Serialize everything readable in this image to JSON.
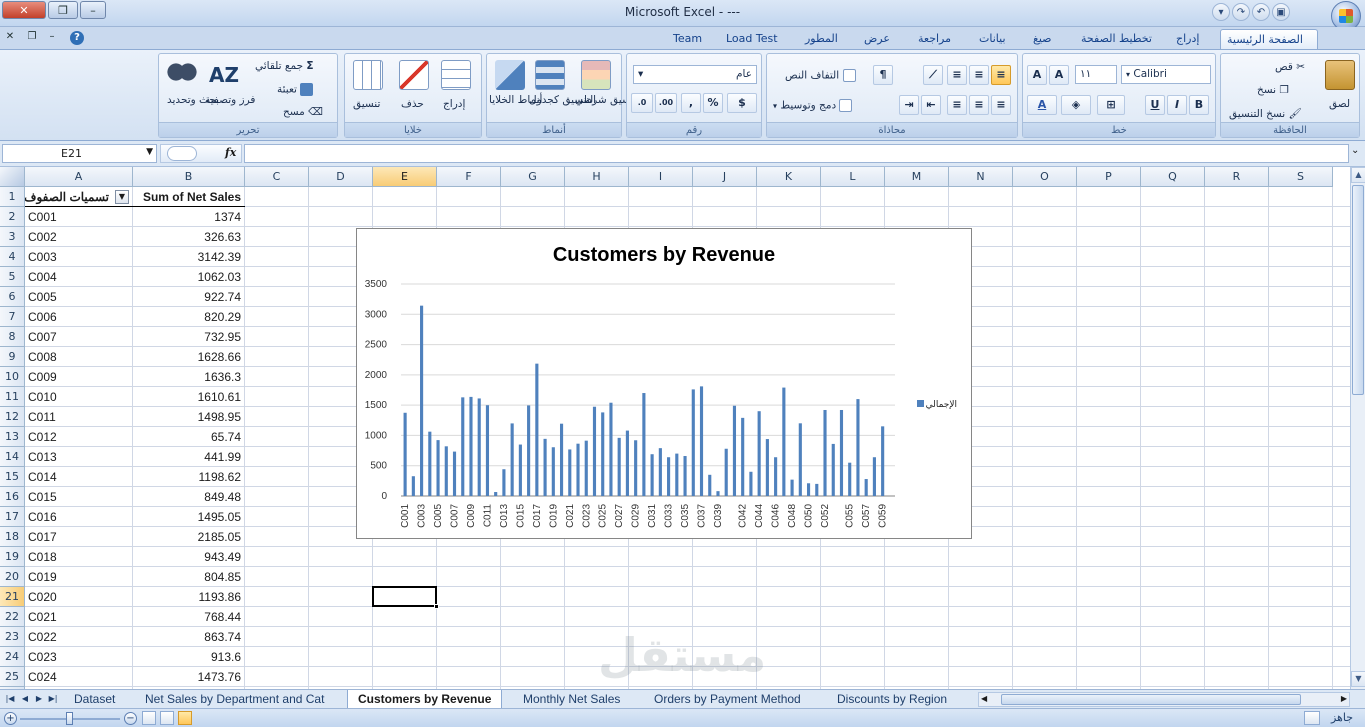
{
  "window": {
    "title": "Microsoft Excel - ---"
  },
  "menu_tabs": [
    {
      "label": "Team"
    },
    {
      "label": "Load Test"
    },
    {
      "label": "المطور"
    },
    {
      "label": "عرض"
    },
    {
      "label": "مراجعة"
    },
    {
      "label": "بيانات"
    },
    {
      "label": "صيغ"
    },
    {
      "label": "تخطيط الصفحة"
    },
    {
      "label": "إدراج"
    },
    {
      "label": "الصفحة الرئيسية"
    }
  ],
  "ribbon": {
    "clipboard": {
      "label": "الحافظة",
      "paste": "لصق",
      "cut": "قص",
      "copy": "نسخ",
      "format_painter": "نسخ التنسيق"
    },
    "font": {
      "label": "خط",
      "font_name": "Calibri",
      "font_size": "١١",
      "bold": "B",
      "italic": "I",
      "underline": "U"
    },
    "alignment": {
      "label": "محاذاة",
      "wrap_text": "التفاف النص",
      "merge_center": "دمج وتوسيط"
    },
    "number": {
      "label": "رقم",
      "format": "عام",
      "percent": "%",
      "comma": ","
    },
    "styles": {
      "label": "أنماط",
      "conditional": "تنسيق شرطي",
      "table": "التنسيق كجدول",
      "cell_styles": "أنماط الخلايا"
    },
    "cells": {
      "label": "خلايا",
      "insert": "إدراج",
      "delete": "حذف",
      "format": "تنسيق"
    },
    "editing": {
      "label": "تحرير",
      "autosum": "جمع تلقائي",
      "fill": "تعبئة",
      "clear": "مسح",
      "sort_filter": "فرز وتصفية",
      "find_select": "بحث وتحديد"
    }
  },
  "formula_bar": {
    "name_box": "E21",
    "fx": "fx",
    "formula": ""
  },
  "columns": [
    "A",
    "B",
    "C",
    "D",
    "E",
    "F",
    "G",
    "H",
    "I",
    "J",
    "K",
    "L",
    "M",
    "N",
    "O",
    "P",
    "Q",
    "R",
    "S"
  ],
  "selected_column": "E",
  "selected_row": "21",
  "table": {
    "header_a": "تسميات الصفوف",
    "header_b": "Sum of Net Sales",
    "rows": [
      {
        "row": "2",
        "id": "C001",
        "value": "1374"
      },
      {
        "row": "3",
        "id": "C002",
        "value": "326.63"
      },
      {
        "row": "4",
        "id": "C003",
        "value": "3142.39"
      },
      {
        "row": "5",
        "id": "C004",
        "value": "1062.03"
      },
      {
        "row": "6",
        "id": "C005",
        "value": "922.74"
      },
      {
        "row": "7",
        "id": "C006",
        "value": "820.29"
      },
      {
        "row": "8",
        "id": "C007",
        "value": "732.95"
      },
      {
        "row": "9",
        "id": "C008",
        "value": "1628.66"
      },
      {
        "row": "10",
        "id": "C009",
        "value": "1636.3"
      },
      {
        "row": "11",
        "id": "C010",
        "value": "1610.61"
      },
      {
        "row": "12",
        "id": "C011",
        "value": "1498.95"
      },
      {
        "row": "13",
        "id": "C012",
        "value": "65.74"
      },
      {
        "row": "14",
        "id": "C013",
        "value": "441.99"
      },
      {
        "row": "15",
        "id": "C014",
        "value": "1198.62"
      },
      {
        "row": "16",
        "id": "C015",
        "value": "849.48"
      },
      {
        "row": "17",
        "id": "C016",
        "value": "1495.05"
      },
      {
        "row": "18",
        "id": "C017",
        "value": "2185.05"
      },
      {
        "row": "19",
        "id": "C018",
        "value": "943.49"
      },
      {
        "row": "20",
        "id": "C019",
        "value": "804.85"
      },
      {
        "row": "21",
        "id": "C020",
        "value": "1193.86"
      },
      {
        "row": "22",
        "id": "C021",
        "value": "768.44"
      },
      {
        "row": "23",
        "id": "C022",
        "value": "863.74"
      },
      {
        "row": "24",
        "id": "C023",
        "value": "913.6"
      },
      {
        "row": "25",
        "id": "C024",
        "value": "1473.76"
      }
    ]
  },
  "chart_data": {
    "type": "bar",
    "title": "Customers by Revenue",
    "legend": "الإجمالي",
    "legend_position": "right",
    "ylim": [
      0,
      3500
    ],
    "yticks": [
      "0",
      "500",
      "1000",
      "1500",
      "2000",
      "2500",
      "3000",
      "3500"
    ],
    "x_tick_labels": [
      "C001",
      "C003",
      "C005",
      "C007",
      "C009",
      "C011",
      "C013",
      "C015",
      "C017",
      "C019",
      "C021",
      "C023",
      "C025",
      "C027",
      "C029",
      "C031",
      "C033",
      "C035",
      "C037",
      "C039",
      "C042",
      "C044",
      "C046",
      "C048",
      "C050",
      "C052",
      "C055",
      "C057",
      "C059"
    ],
    "categories": [
      "C001",
      "C002",
      "C003",
      "C004",
      "C005",
      "C006",
      "C007",
      "C008",
      "C009",
      "C010",
      "C011",
      "C012",
      "C013",
      "C014",
      "C015",
      "C016",
      "C017",
      "C018",
      "C019",
      "C020",
      "C021",
      "C022",
      "C023",
      "C024",
      "C025",
      "C026",
      "C027",
      "C028",
      "C029",
      "C030",
      "C031",
      "C032",
      "C033",
      "C034",
      "C035",
      "C036",
      "C037",
      "C038",
      "C039",
      "C040",
      "C041",
      "C042",
      "C043",
      "C044",
      "C045",
      "C046",
      "C047",
      "C048",
      "C049",
      "C050",
      "C051",
      "C052",
      "C053",
      "C054",
      "C055",
      "C056",
      "C057",
      "C058",
      "C059",
      "C060"
    ],
    "values": [
      1374,
      326.63,
      3142.39,
      1062.03,
      922.74,
      820.29,
      732.95,
      1628.66,
      1636.3,
      1610.61,
      1498.95,
      65.74,
      441.99,
      1198.62,
      849.48,
      1495.05,
      2185.05,
      943.49,
      804.85,
      1193.86,
      768.44,
      863.74,
      913.6,
      1473.76,
      1380,
      1540,
      960,
      1080,
      920,
      1700,
      690,
      790,
      640,
      700,
      660,
      1760,
      1810,
      350,
      80,
      780,
      1490,
      1290,
      400,
      1400,
      940,
      640,
      1790,
      270,
      1200,
      210,
      200,
      1420,
      860,
      1420,
      550,
      1600,
      280,
      640,
      1150,
      0
    ],
    "bar_color": "#4f81bd"
  },
  "sheets": [
    {
      "label": "Dataset"
    },
    {
      "label": "Net Sales by Department and Cat"
    },
    {
      "label": "Customers by Revenue",
      "active": true
    },
    {
      "label": "Monthly Net Sales"
    },
    {
      "label": "Orders by Payment Method"
    },
    {
      "label": "Discounts by Region"
    }
  ],
  "status": {
    "ready": "جاهز"
  },
  "watermark": "مستقل"
}
